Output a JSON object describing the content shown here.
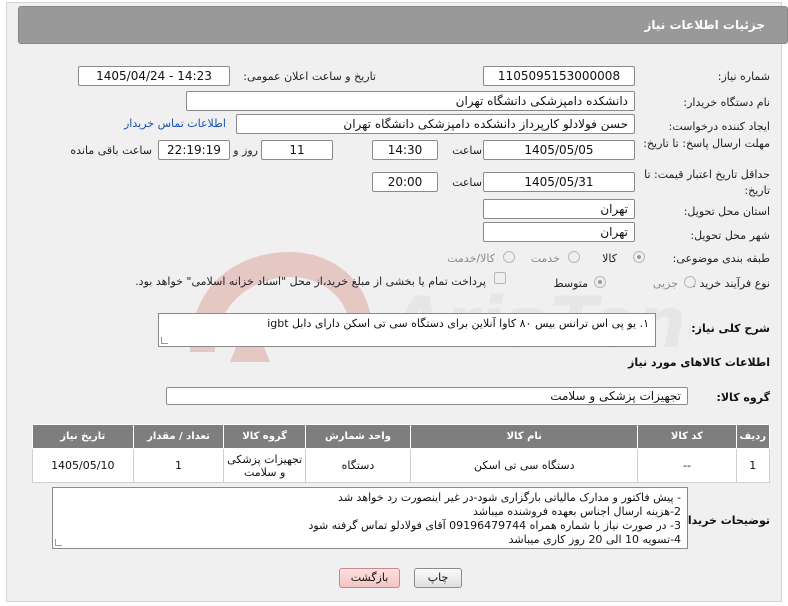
{
  "header": {
    "title": "جزئیات اطلاعات نیاز"
  },
  "fields": {
    "need_number_label": "شماره نیاز:",
    "need_number": "1105095153000008",
    "announce_label": "تاریخ و ساعت اعلان عمومی:",
    "announce_value": "1405/04/24 - 14:23",
    "buyer_org_label": "نام دستگاه خریدار:",
    "buyer_org": "دانشکده دامپزشکی دانشگاه تهران",
    "creator_label": "ایجاد کننده درخواست:",
    "creator": "حسن فولادلو کارپرداز دانشکده دامپزشکی دانشگاه تهران",
    "contact_link": "اطلاعات تماس خریدار",
    "deadline_label": "مهلت ارسال پاسخ: تا تاریخ:",
    "deadline_date": "1405/05/05",
    "time_label": "ساعت",
    "deadline_time": "14:30",
    "days": "11",
    "days_label": "روز و",
    "remaining_time": "22:19:19",
    "remaining_label": "ساعت باقی مانده",
    "price_validity_label": "حداقل تاریخ اعتبار قیمت: تا تاریخ:",
    "price_date": "1405/05/31",
    "price_time": "20:00",
    "province_label": "استان محل تحویل:",
    "province": "تهران",
    "city_label": "شهر محل تحویل:",
    "city": "تهران",
    "category_label": "طبقه بندی موضوعی:",
    "category_options": [
      "کالا",
      "خدمت",
      "کالا/خدمت"
    ],
    "process_label": "نوع فرآیند خرید :",
    "process_options": [
      "جزیی",
      "متوسط"
    ],
    "payment_note": "پرداخت تمام یا بخشی از مبلغ خرید،از محل \"اسناد خزانه اسلامی\" خواهد بود."
  },
  "description": {
    "label": "شرح کلی نیاز:",
    "text": "١. یو پی اس ترانس بیس ٨٠ کاوا آنلاین برای دستگاه سی تی اسکن دارای دابل igbt"
  },
  "goods": {
    "section_title": "اطلاعات کالاهای مورد نیاز",
    "group_label": "گروه کالا:",
    "group_value": "تجهیزات پزشکی و سلامت",
    "headers": [
      "ردیف",
      "کد کالا",
      "نام کالا",
      "واحد شمارش",
      "گروه کالا",
      "تعداد / مقدار",
      "تاریخ نیاز"
    ],
    "rows": [
      [
        "1",
        "--",
        "دستگاه سی تی اسکن",
        "دستگاه",
        "تجهیزات پزشکی و سلامت",
        "1",
        "1405/05/10"
      ]
    ]
  },
  "buyer_notes": {
    "label": "توضیحات خریدار:",
    "lines": [
      "- پیش  فاکتور و مدارک مالیاتی بارگزاری شود-در غیر اینصورت رد خواهد شد",
      "2-هزینه ارسال  اجناس بعهده فروشنده میباشد",
      "3- در صورت نیاز با شماره همراه 09196479744  آقای  فولادلو  تماس گرفته شود",
      "4-تسویه 10 الی 20 روز کاری میباشد"
    ]
  },
  "buttons": {
    "print": "چاپ",
    "back": "بازگشت"
  }
}
